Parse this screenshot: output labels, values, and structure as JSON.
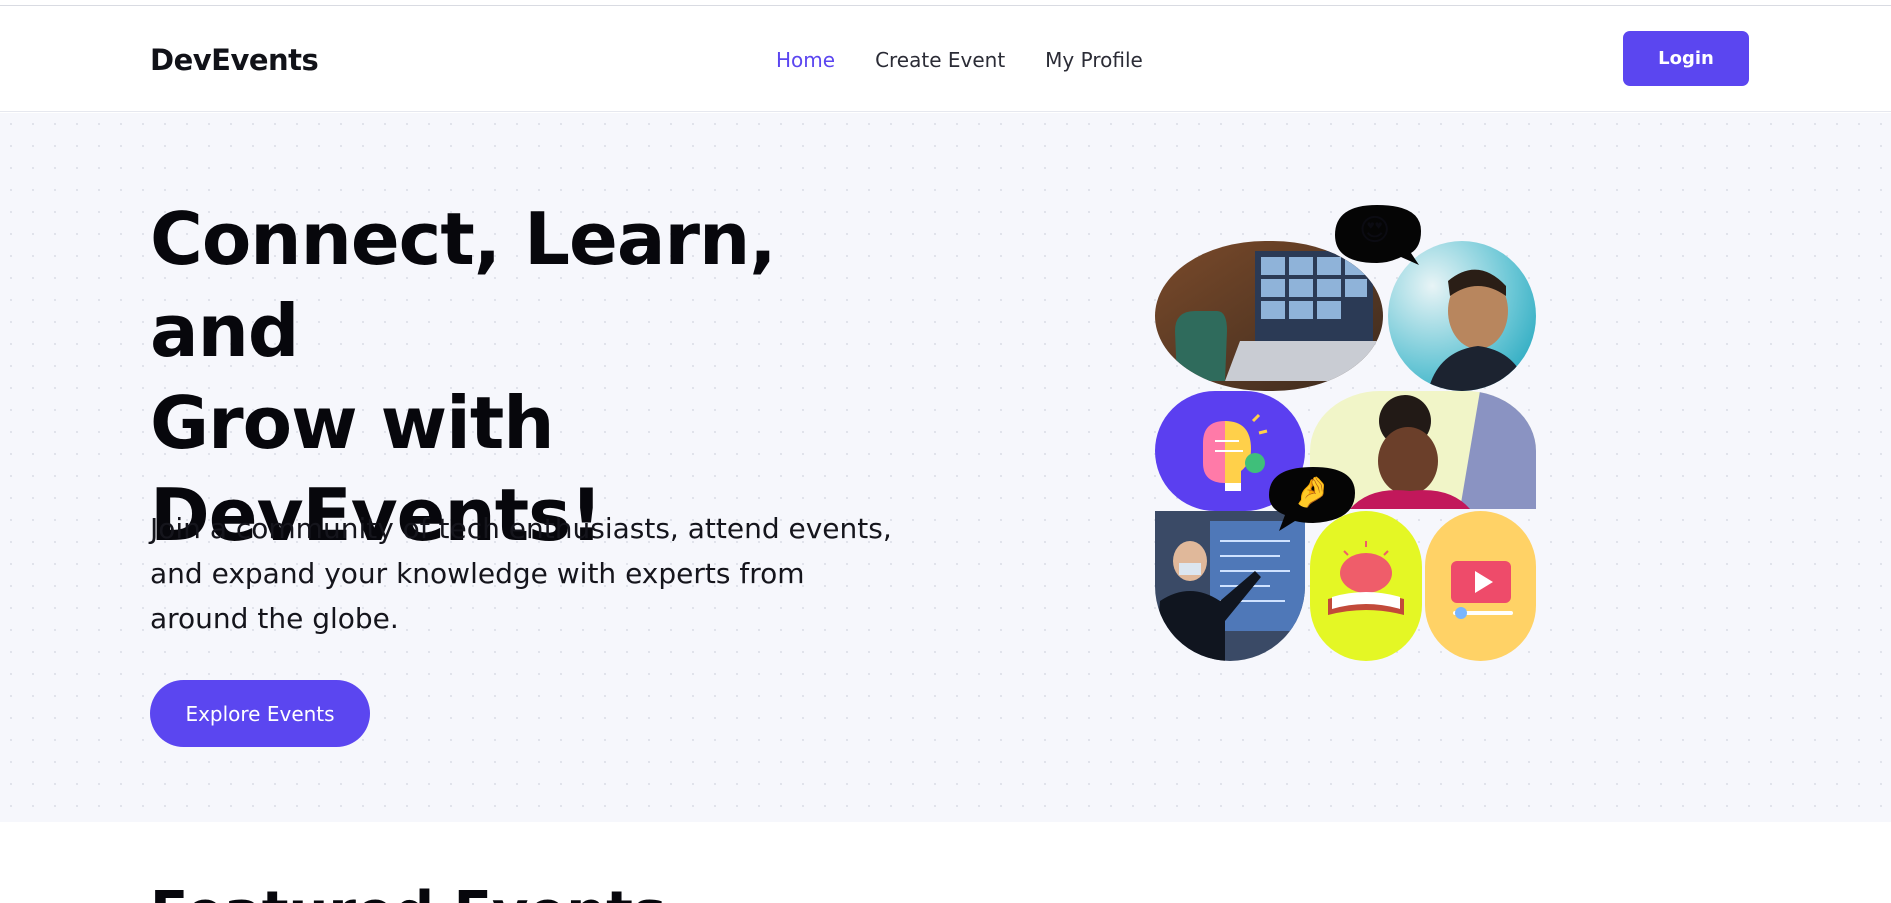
{
  "colors": {
    "accent": "#5b46f0",
    "hero_bg": "#f6f7fc",
    "tile_purple": "#5b3ff0",
    "tile_lime": "#e4f725",
    "tile_yellow": "#ffd266"
  },
  "navbar": {
    "brand": "DevEvents",
    "links": [
      {
        "label": "Home",
        "active": true
      },
      {
        "label": "Create Event",
        "active": false
      },
      {
        "label": "My Profile",
        "active": false
      }
    ],
    "login_label": "Login"
  },
  "hero": {
    "title_lines": [
      "Connect, Learn, and",
      "Grow with",
      "DevEvents!"
    ],
    "subtitle_lines": [
      "Join a community of tech enthusiasts, attend events,",
      "and expand your knowledge with experts from",
      "around the globe."
    ],
    "cta_label": "Explore Events"
  },
  "collage": {
    "tiles": [
      {
        "name": "video-call-laptop-photo"
      },
      {
        "name": "smiling-man-photo"
      },
      {
        "name": "brain-lightbulb-icon"
      },
      {
        "name": "excited-woman-photo"
      },
      {
        "name": "presenter-photo"
      },
      {
        "name": "brain-book-icon"
      },
      {
        "name": "video-play-icon"
      }
    ],
    "bubbles": [
      {
        "name": "heart-eyes-emoji-bubble",
        "emoji": "😍"
      },
      {
        "name": "pinching-hand-emoji-bubble",
        "emoji": "🤌"
      }
    ]
  },
  "featured": {
    "heading": "Featured Events"
  }
}
